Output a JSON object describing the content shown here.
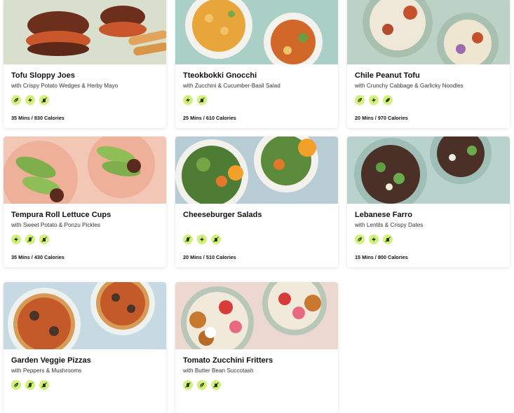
{
  "recipes": [
    {
      "title": "Tofu Sloppy Joes",
      "subtitle": "with Crispy Potato Wedges & Herby Mayo",
      "meta": "35 Mins / 830 Calories",
      "badges": [
        "leaf-icon",
        "bolt-icon",
        "no-dairy-icon"
      ],
      "bg": "#d8dfcd"
    },
    {
      "title": "Tteokbokki Gnocchi",
      "subtitle": "with Zucchini & Cucumber-Basil Salad",
      "meta": "25 Mins / 610 Calories",
      "badges": [
        "bolt-icon",
        "no-dairy-icon"
      ],
      "bg": "#a9cfc7"
    },
    {
      "title": "Chile Peanut Tofu",
      "subtitle": "with Crunchy Cabbage & Garlicky Noodles",
      "meta": "20 Mins / 970 Calories",
      "badges": [
        "leaf-icon",
        "bolt-icon",
        "feather-icon"
      ],
      "bg": "#bdd2c6"
    },
    {
      "title": "Tempura Roll Lettuce Cups",
      "subtitle": "with Sweet Potato & Ponzu Pickles",
      "meta": "35 Mins / 430 Calories",
      "badges": [
        "bolt-icon",
        "no-gluten-icon",
        "no-dairy-icon"
      ],
      "bg": "#f2c7b6"
    },
    {
      "title": "Cheeseburger Salads",
      "subtitle": "",
      "meta": "20 Mins / 510 Calories",
      "badges": [
        "no-gluten-icon",
        "bolt-icon",
        "no-dairy-icon"
      ],
      "bg": "#b8ccd6"
    },
    {
      "title": "Lebanese Farro",
      "subtitle": "with Lentils & Crispy Dates",
      "meta": "15 Mins / 800 Calories",
      "badges": [
        "leaf-icon",
        "bolt-icon",
        "no-dairy-icon"
      ],
      "bg": "#b9d3cc"
    },
    {
      "title": "Garden Veggie Pizzas",
      "subtitle": "with Peppers & Mushrooms",
      "meta": "",
      "badges": [
        "leaf-icon",
        "no-gluten-icon",
        "no-dairy-icon"
      ],
      "bg": "#c7dae4"
    },
    {
      "title": "Tomato Zucchini Fritters",
      "subtitle": "with Butter Bean Succotash",
      "meta": "",
      "badges": [
        "no-gluten-icon",
        "leaf-icon",
        "no-dairy-icon"
      ],
      "bg": "#ecd8d0"
    }
  ]
}
